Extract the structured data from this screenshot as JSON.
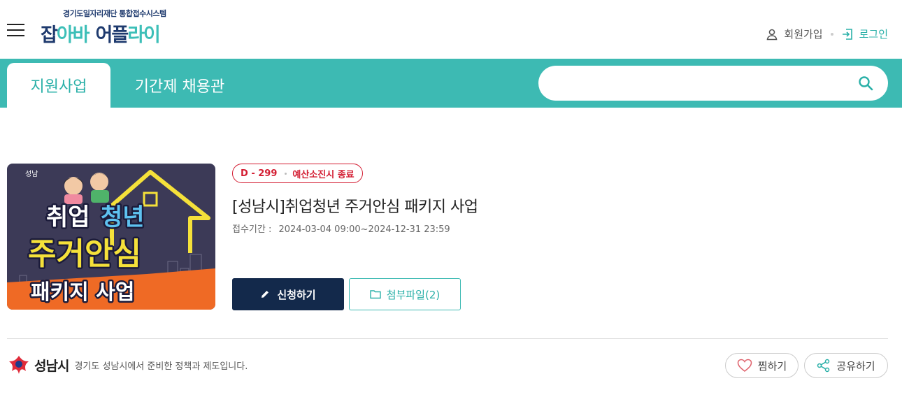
{
  "header": {
    "logo_sub": "경기도일자리재단 통합접수시스템",
    "logo_part1": "잡",
    "logo_part2": "아바",
    "logo_part3": "어플",
    "logo_part4": "라이",
    "signup_label": "회원가입",
    "login_label": "로그인"
  },
  "nav": {
    "tabs": [
      {
        "label": "지원사업",
        "active": true
      },
      {
        "label": "기간제 채용관",
        "active": false
      }
    ],
    "search": {
      "value": "",
      "placeholder": ""
    }
  },
  "program": {
    "dday": "D - 299",
    "status": "예산소진시 종료",
    "title": "[성남시]취업청년 주거안심 패키지 사업",
    "period_label": "접수기간 :",
    "period_value": "2024-03-04 09:00~2024-12-31 23:59",
    "thumbnail": {
      "line1_a": "취업",
      "line1_b": "청년",
      "line2": "주거안심",
      "line3": "패키지 사업",
      "city_logo": "성남"
    },
    "apply_label": "신청하기",
    "attachment_label": "첨부파일(2)"
  },
  "footer": {
    "org_name": "성남시",
    "org_desc": "경기도 성남시에서 준비한 정책과 제도입니다.",
    "like_label": "찜하기",
    "share_label": "공유하기"
  },
  "colors": {
    "teal": "#3dbab3",
    "navy": "#13294b",
    "red": "#d31d32",
    "thumb_bg": "#3c3a57",
    "thumb_orange": "#ef6a25",
    "thumb_yellow": "#f5e13a"
  },
  "icons": [
    "menu-icon",
    "user-icon",
    "login-icon",
    "search-icon",
    "pencil-icon",
    "folder-icon",
    "heart-icon",
    "share-icon"
  ]
}
